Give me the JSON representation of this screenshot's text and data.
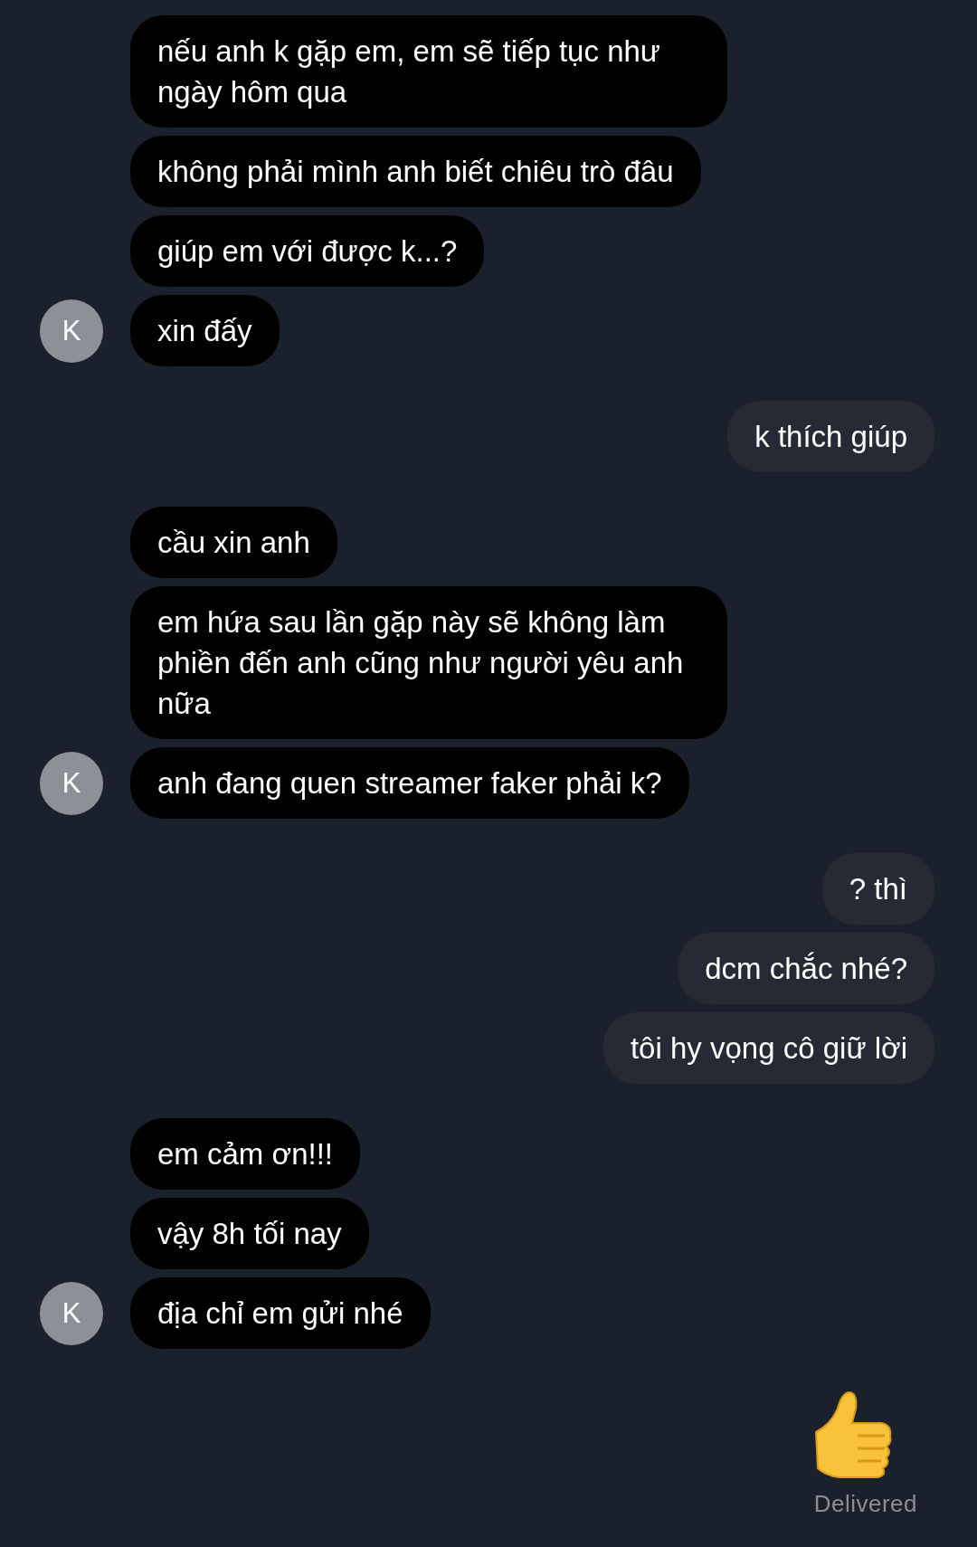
{
  "conversation": [
    {
      "kind": "incoming",
      "avatar": "K",
      "messages": [
        "nếu anh k gặp em, em sẽ tiếp tục như ngày hôm qua",
        "không phải mình anh biết chiêu trò đâu",
        "giúp em với được k...?",
        "xin đấy"
      ]
    },
    {
      "kind": "outgoing",
      "messages": [
        "k thích giúp"
      ]
    },
    {
      "kind": "incoming",
      "avatar": "K",
      "messages": [
        "cầu xin anh",
        "em hứa sau lần gặp này sẽ không làm phiền đến anh cũng như người yêu anh nữa",
        "anh đang quen streamer faker phải k?"
      ]
    },
    {
      "kind": "outgoing",
      "messages": [
        "? thì",
        "dcm chắc nhé?",
        "tôi hy vọng cô giữ lời"
      ]
    },
    {
      "kind": "incoming",
      "avatar": "K",
      "messages": [
        "em cảm ơn!!!",
        "vậy 8h tối nay",
        "địa chỉ em gửi nhé"
      ]
    }
  ],
  "reaction": {
    "kind": "thumbs_up"
  },
  "status": "Delivered"
}
